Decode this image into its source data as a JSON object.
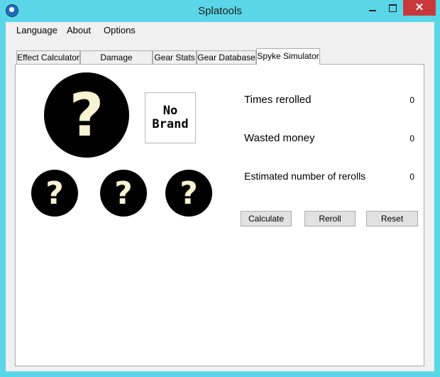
{
  "window": {
    "title": "Splatools",
    "close_glyph": "✕"
  },
  "menu": {
    "items": [
      "Language",
      "About",
      "Options"
    ]
  },
  "tabs": [
    {
      "label": "Effect Calculator"
    },
    {
      "label": "Damage Calculator"
    },
    {
      "label": "Gear Stats"
    },
    {
      "label": "Gear Database"
    },
    {
      "label": "Spyke Simulator",
      "active": true
    }
  ],
  "simulator": {
    "main_ability_icon": "?",
    "sub_ability_icons": [
      "?",
      "?",
      "?"
    ],
    "brand": {
      "line1": "No",
      "line2": "Brand"
    },
    "stats": [
      {
        "label": "Times rerolled",
        "value": "0"
      },
      {
        "label": "Wasted money",
        "value": "0"
      },
      {
        "label": "Estimated number of rerolls",
        "value": "0"
      }
    ],
    "buttons": {
      "calculate": "Calculate",
      "reroll": "Reroll",
      "reset": "Reset"
    }
  },
  "colors": {
    "frame": "#5ad6e8",
    "close_button": "#c8383b",
    "question_mark": "#f7f2d2"
  }
}
